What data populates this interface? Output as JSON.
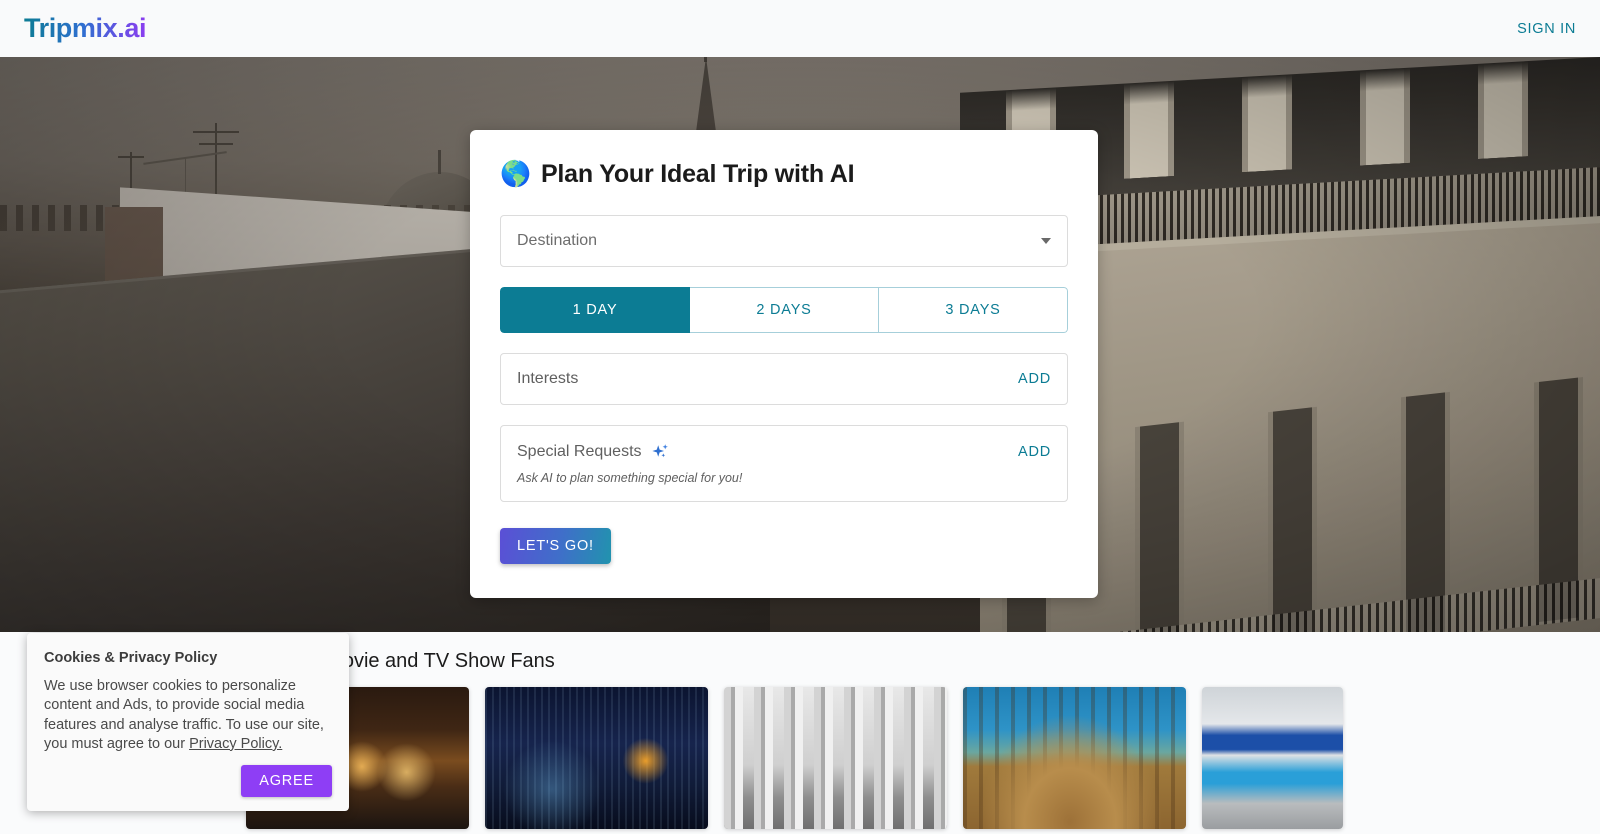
{
  "header": {
    "logo": "Tripmix.ai",
    "sign_in": "SIGN IN"
  },
  "planner": {
    "globe_icon": "🌎",
    "title": "Plan Your Ideal Trip with AI",
    "destination": {
      "placeholder": "Destination",
      "value": "",
      "caret_icon": "chevron-down-icon"
    },
    "duration": {
      "selected": "1 DAY",
      "options": [
        "1 DAY",
        "2 DAYS",
        "3 DAYS"
      ]
    },
    "interests": {
      "label": "Interests",
      "add_label": "ADD"
    },
    "special_requests": {
      "label": "Special Requests",
      "sparkle_icon": "ai-sparkle-icon",
      "add_label": "ADD",
      "hint": "Ask AI to plan something special for you!"
    },
    "submit_label": "LET'S GO!"
  },
  "collections": {
    "section_title": "Trips for Movie and TV Show Fans",
    "cards": [
      {
        "name": "sherlock-holmes-pub"
      },
      {
        "name": "tokyo-tower-skyline"
      },
      {
        "name": "paris-bir-hakeim-bridge"
      },
      {
        "name": "rome-colosseum"
      },
      {
        "name": "toms-restaurant-nyc"
      }
    ]
  },
  "cookie_banner": {
    "title": "Cookies & Privacy Policy",
    "body": "We use browser cookies to personalize content and Ads, to provide social media features and analyse traffic. To use our site, you must agree to our ",
    "link_text": "Privacy Policy.",
    "agree_label": "AGREE"
  },
  "colors": {
    "teal": "#0c7c94",
    "purple": "#8e3ef5",
    "gradient_start": "#5b4fd6",
    "gradient_end": "#2193ae"
  }
}
